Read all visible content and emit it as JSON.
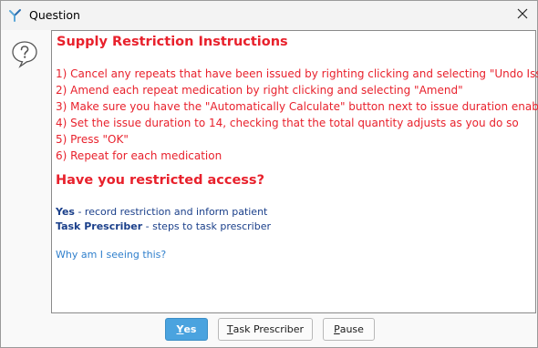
{
  "window": {
    "title": "Question"
  },
  "content": {
    "heading": "Supply Restriction Instructions",
    "instructions": [
      "1) Cancel any repeats that have been issued by righting clicking and selecting \"Undo Issue\"",
      "2) Amend each repeat medication by right clicking and selecting \"Amend\"",
      "3) Make sure you have the \"Automatically Calculate\" button next to issue duration enabled",
      "4) Set the issue duration to 14, checking that the total quantity adjusts as you do so",
      "5) Press \"OK\"",
      "6) Repeat for each medication"
    ],
    "question": "Have you restricted access?",
    "options": [
      {
        "label": "Yes",
        "description": " - record restriction and inform patient"
      },
      {
        "label": "Task Prescriber",
        "description": " - steps to task prescriber"
      }
    ],
    "why_link": "Why am I seeing this?"
  },
  "buttons": {
    "yes": {
      "mnemonic": "Y",
      "rest": "es"
    },
    "task_prescriber": {
      "mnemonic": "T",
      "rest": "ask Prescriber"
    },
    "pause": {
      "mnemonic": "P",
      "rest": "ause"
    }
  },
  "colors": {
    "instruction_red": "#e8212c",
    "option_blue": "#1a3f8a",
    "link_blue": "#2f7fcc",
    "primary_button": "#4aa3df"
  },
  "icons": {
    "app": "app-logo-icon",
    "close": "close-icon",
    "side": "question-bubble-icon"
  }
}
